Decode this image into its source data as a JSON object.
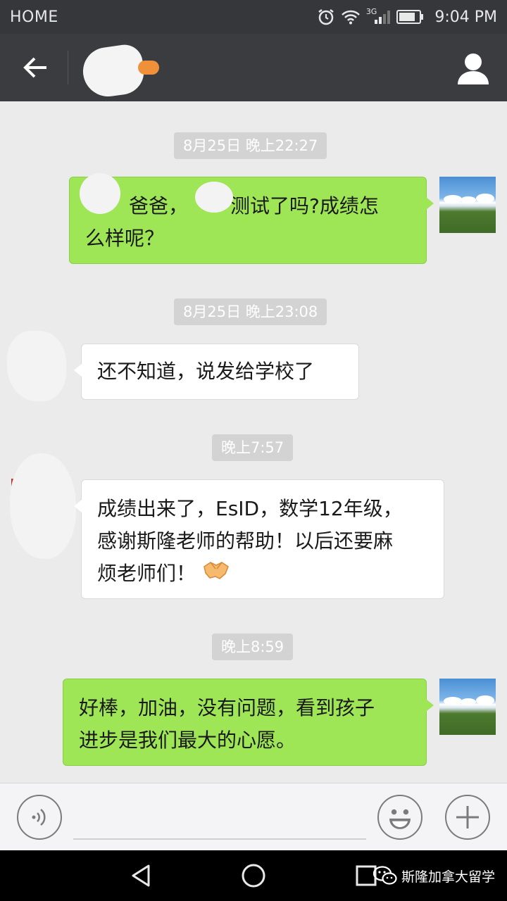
{
  "status_bar": {
    "carrier": "HOME",
    "network_badge": "3G",
    "time": "9:04 PM"
  },
  "header": {
    "back_icon": "back-arrow-icon",
    "profile_icon": "person-icon"
  },
  "messages": [
    {
      "timestamp": "8月25日 晚上22:27",
      "sender": "me",
      "segments": [
        "爸爸，",
        "测试了吗?成绩怎",
        "么样呢？"
      ]
    },
    {
      "timestamp": "8月25日 晚上23:08",
      "sender": "other",
      "segments": [
        "还不知道，说发给学校了"
      ]
    },
    {
      "timestamp": "晚上7:57",
      "sender": "other",
      "segments": [
        "成绩出来了，EsID，数学12年级，",
        "感谢斯隆老师的帮助！以后还要麻",
        "烦老师们！"
      ],
      "emoji": "handshake-emoji"
    },
    {
      "timestamp": "晚上8:59",
      "sender": "me",
      "segments": [
        "好棒，加油，没有问题，看到孩子",
        "进步是我们最大的心愿。"
      ]
    }
  ],
  "input_bar": {
    "voice_icon": "voice-icon",
    "emoji_icon": "smiley-icon",
    "plus_icon": "plus-icon",
    "input_value": ""
  },
  "nav_bar": {
    "back_icon": "nav-back-icon",
    "home_icon": "nav-home-icon",
    "recents_icon": "nav-recents-icon"
  },
  "watermark": {
    "text": "斯隆加拿大留学",
    "icon": "wechat-icon"
  },
  "colors": {
    "my_bubble": "#9fe657",
    "their_bubble": "#ffffff",
    "header_bg": "#3a3c40",
    "chat_bg": "#ebebeb"
  }
}
